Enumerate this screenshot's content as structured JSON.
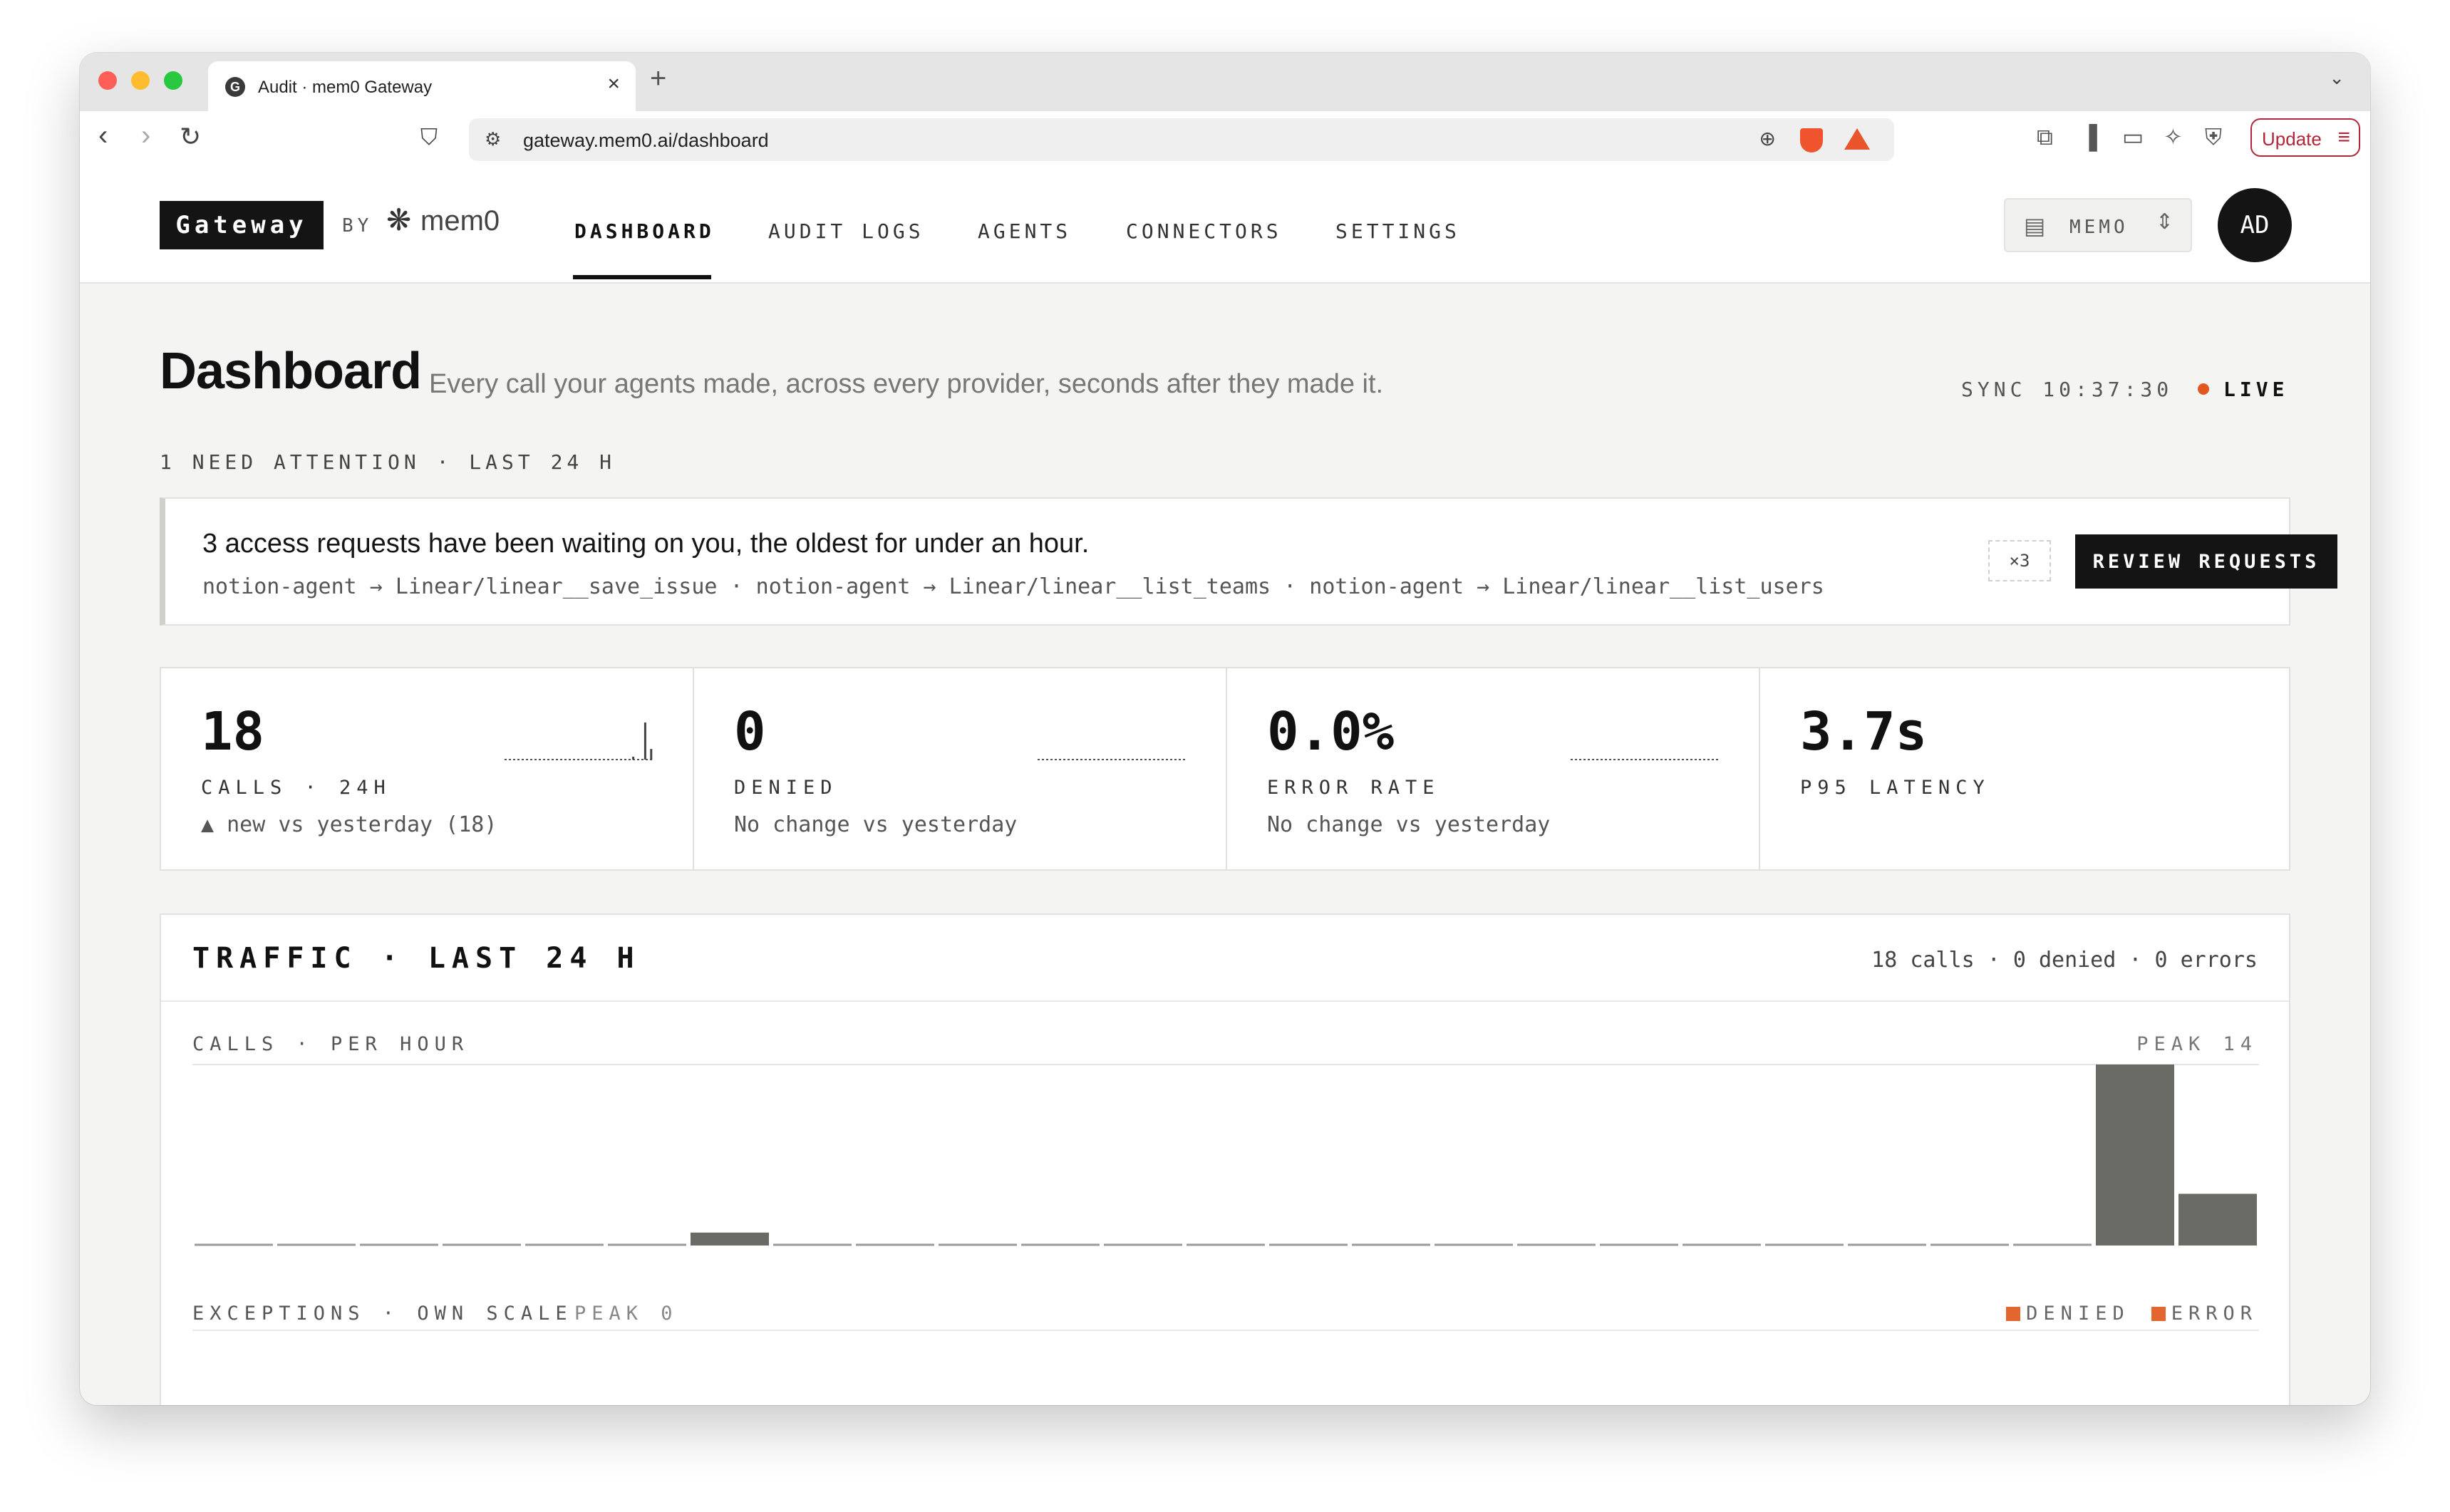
{
  "browser": {
    "tab_title": "Audit · mem0 Gateway",
    "tab_favicon": "G",
    "url": "gateway.mem0.ai/dashboard",
    "update_label": "Update"
  },
  "header": {
    "brand": "Gateway",
    "by": "BY",
    "partner": "mem0",
    "nav": [
      "DASHBOARD",
      "AUDIT LOGS",
      "AGENTS",
      "CONNECTORS",
      "SETTINGS"
    ],
    "active_nav": "DASHBOARD",
    "org": "MEMO",
    "avatar": "AD"
  },
  "page": {
    "title": "Dashboard",
    "subtitle": "Every call your agents made, across every provider, seconds after they made it.",
    "sync": "SYNC 10:37:30",
    "live": "LIVE",
    "attention": "1 NEED ATTENTION · LAST 24 H"
  },
  "alert": {
    "message": "3 access requests have been waiting on you, the oldest for under an hour.",
    "details": "notion-agent → Linear/linear__save_issue · notion-agent → Linear/linear__list_teams · notion-agent → Linear/linear__list_users",
    "count": "×3",
    "action": "REVIEW REQUESTS"
  },
  "stats": [
    {
      "value": "18",
      "label": "CALLS · 24H",
      "note": "▲ new vs yesterday (18)",
      "spark": [
        0,
        0,
        0,
        0,
        0,
        0,
        0,
        0,
        0,
        0,
        0,
        0,
        0,
        0,
        0,
        0,
        0,
        0,
        0,
        0,
        0,
        1,
        0,
        14,
        4
      ]
    },
    {
      "value": "0",
      "label": "DENIED",
      "note": "No change vs yesterday",
      "spark": [
        0,
        0,
        0,
        0,
        0,
        0,
        0,
        0,
        0,
        0,
        0,
        0,
        0,
        0,
        0,
        0,
        0,
        0,
        0,
        0,
        0,
        0,
        0,
        0,
        0
      ]
    },
    {
      "value": "0.0%",
      "label": "ERROR RATE",
      "note": "No change vs yesterday",
      "spark": [
        0,
        0,
        0,
        0,
        0,
        0,
        0,
        0,
        0,
        0,
        0,
        0,
        0,
        0,
        0,
        0,
        0,
        0,
        0,
        0,
        0,
        0,
        0,
        0,
        0
      ]
    },
    {
      "value": "3.7s",
      "label": "P95 LATENCY",
      "note": ""
    }
  ],
  "traffic": {
    "title": "TRAFFIC · LAST 24 H",
    "summary": "18 calls · 0 denied · 0 errors",
    "calls_label": "CALLS · PER HOUR",
    "calls_peak": "PEAK 14",
    "exceptions_label": "EXCEPTIONS · OWN SCALE",
    "exceptions_peak": "PEAK 0",
    "legend_denied": "DENIED",
    "legend_error": "ERROR"
  },
  "chart_data": {
    "type": "bar",
    "title": "CALLS · PER HOUR",
    "series": [
      {
        "name": "calls",
        "values": [
          0,
          0,
          0,
          0,
          0,
          0,
          1,
          0,
          0,
          0,
          0,
          0,
          0,
          0,
          0,
          0,
          0,
          0,
          0,
          0,
          0,
          0,
          0,
          14,
          4
        ]
      }
    ],
    "peak": 14,
    "ylim": [
      0,
      14
    ],
    "colors": {
      "bar": "#6b6b66",
      "baseline": "#9a9a96",
      "denied": "#e2662e",
      "error": "#e2662e"
    }
  }
}
